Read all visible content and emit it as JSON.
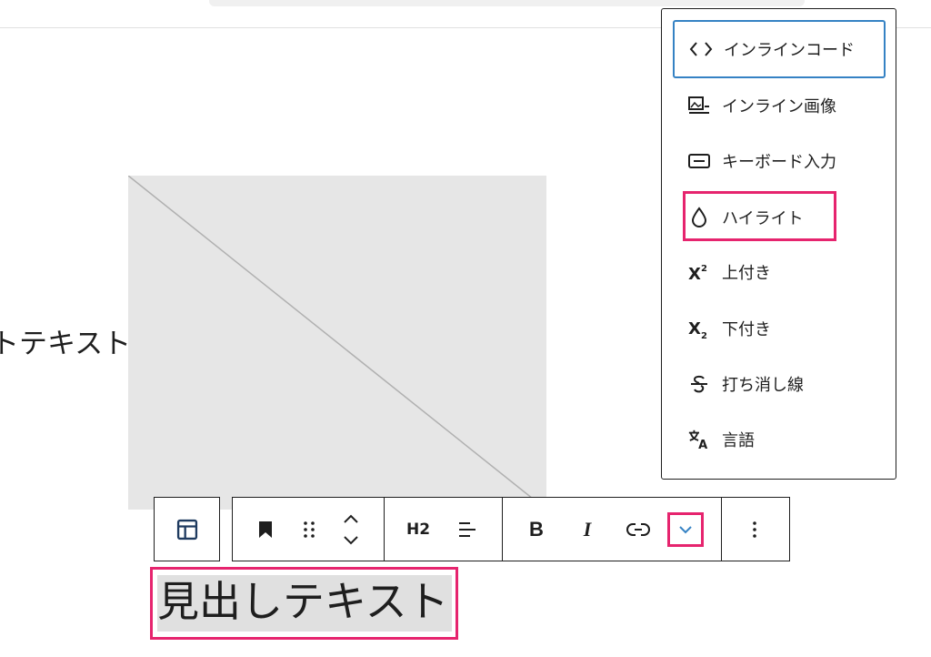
{
  "page": {
    "side_text": "トテキスト",
    "heading_text": "見出しテキスト"
  },
  "toolbar": {
    "heading_level": "H2",
    "bold": "B",
    "italic": "I"
  },
  "dropdown": {
    "items": [
      {
        "label": "インラインコード",
        "icon": "code-icon"
      },
      {
        "label": "インライン画像",
        "icon": "image-icon"
      },
      {
        "label": "キーボード入力",
        "icon": "keyboard-icon"
      },
      {
        "label": "ハイライト",
        "icon": "droplet-icon"
      },
      {
        "label": "上付き",
        "icon": "superscript-icon"
      },
      {
        "label": "下付き",
        "icon": "subscript-icon"
      },
      {
        "label": "打ち消し線",
        "icon": "strikethrough-icon"
      },
      {
        "label": "言語",
        "icon": "language-icon"
      }
    ]
  },
  "colors": {
    "accent_pink": "#e6246e",
    "focus_blue": "#3582c4",
    "text_dark": "#1e1e1e",
    "placeholder_gray": "#e6e6e6"
  }
}
